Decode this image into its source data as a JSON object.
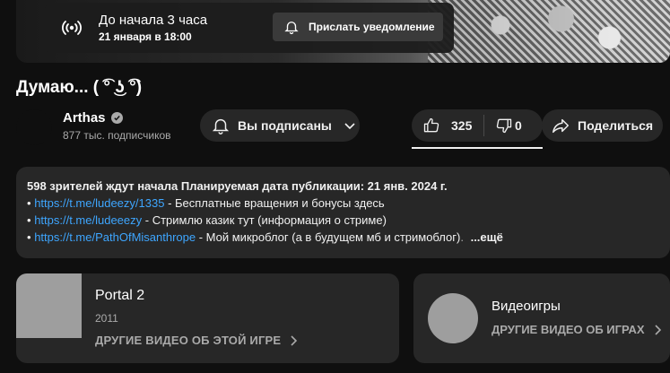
{
  "premiere": {
    "countdown": "До начала 3 часа",
    "date": "21 января в 18:00",
    "notify_label": "Прислать уведомление"
  },
  "video": {
    "title": "Думаю... ( ͡° ͜ʖ ͡°)"
  },
  "channel": {
    "name": "Arthas",
    "subscribers": "877 тыс. подписчиков",
    "subscribe_label": "Вы подписаны"
  },
  "actions": {
    "likes": "325",
    "dislikes": "0",
    "share_label": "Поделиться"
  },
  "description": {
    "meta": "598 зрителей ждут начала  Планируемая дата публикации: 21 янв. 2024 г.",
    "lines": [
      {
        "bullet": "•",
        "link": "https://t.me/ludeezy/1335",
        "text": " - Бесплатные вращения и бонусы здесь"
      },
      {
        "bullet": "•",
        "link": "https://t.me/ludeeezy",
        "text": " - Стримлю казик тут (информация о стриме)"
      },
      {
        "bullet": "•",
        "link": "https://t.me/PathOfMisanthrope",
        "text": "  - Мой микроблог (а в будущем мб и стримоблог)",
        "faded": "."
      }
    ],
    "more_label": "...ещё"
  },
  "game_card": {
    "title": "Portal 2",
    "year": "2011",
    "more_label": "ДРУГИЕ ВИДЕО ОБ ЭТОЙ ИГРЕ"
  },
  "category_card": {
    "title": "Видеоигры",
    "more_label": "ДРУГИЕ ВИДЕО ОБ ИГРАХ"
  },
  "icons": {
    "live": "live-broadcast-icon",
    "bell": "bell-icon",
    "chevron": "chevron-down-icon",
    "like": "thumbs-up-icon",
    "dislike": "thumbs-down-icon",
    "share": "share-icon",
    "verified": "verified-check-icon",
    "chevron_right": "chevron-right-icon"
  },
  "colors": {
    "background": "#0f0f0f",
    "surface": "#272727",
    "link": "#3ea6ff",
    "muted": "#aaaaaa"
  }
}
